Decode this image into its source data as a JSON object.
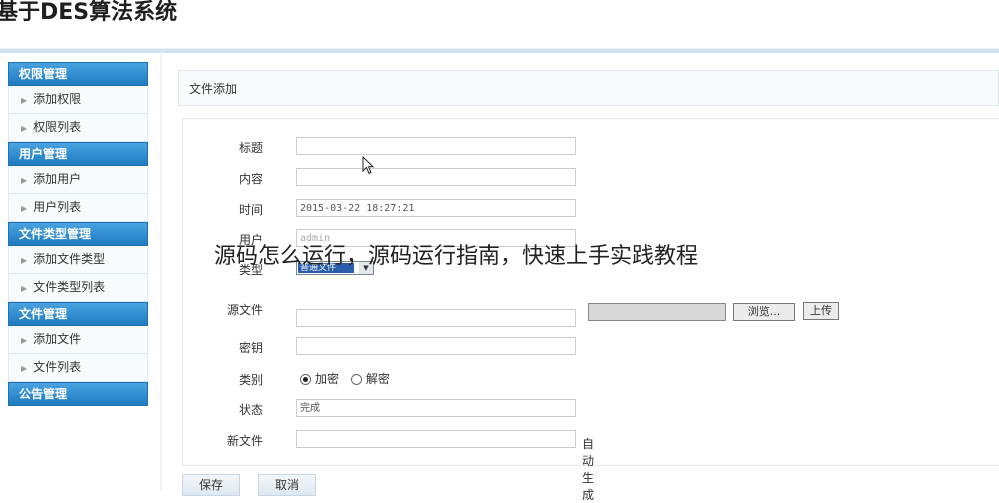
{
  "app": {
    "title": "基于DES算法系统"
  },
  "sidebar": {
    "groups": [
      {
        "title": "权限管理",
        "items": [
          "添加权限",
          "权限列表"
        ]
      },
      {
        "title": "用户管理",
        "items": [
          "添加用户",
          "用户列表"
        ]
      },
      {
        "title": "文件类型管理",
        "items": [
          "添加文件类型",
          "文件类型列表"
        ]
      },
      {
        "title": "文件管理",
        "items": [
          "添加文件",
          "文件列表"
        ]
      },
      {
        "title": "公告管理",
        "items": []
      }
    ]
  },
  "breadcrumb": "文件添加",
  "form": {
    "title_label": "标题",
    "title_value": "",
    "content_label": "内容",
    "content_value": "",
    "time_label": "时间",
    "time_value": "2015-03-22 18:27:21",
    "user_label": "用户",
    "user_value": "admin",
    "type_label": "类型",
    "type_value": "普通文件",
    "source_label": "源文件",
    "source_value": "",
    "browse_label": "浏览...",
    "upload_label": "上传",
    "key_label": "密钥",
    "key_value": "",
    "category_label": "类别",
    "category_options": [
      "加密",
      "解密"
    ],
    "category_selected": "加密",
    "status_label": "状态",
    "status_value": "完成",
    "newfile_label": "新文件",
    "newfile_value": "",
    "newfile_hint": "自动生成"
  },
  "buttons": {
    "save": "保存",
    "cancel": "取消"
  },
  "overlay": {
    "watermark": "源码怎么运行，源码运行指南，快速上手实践教程"
  },
  "colors": {
    "accent": "#2a8bd0",
    "header_line": "#cfe3f0"
  }
}
